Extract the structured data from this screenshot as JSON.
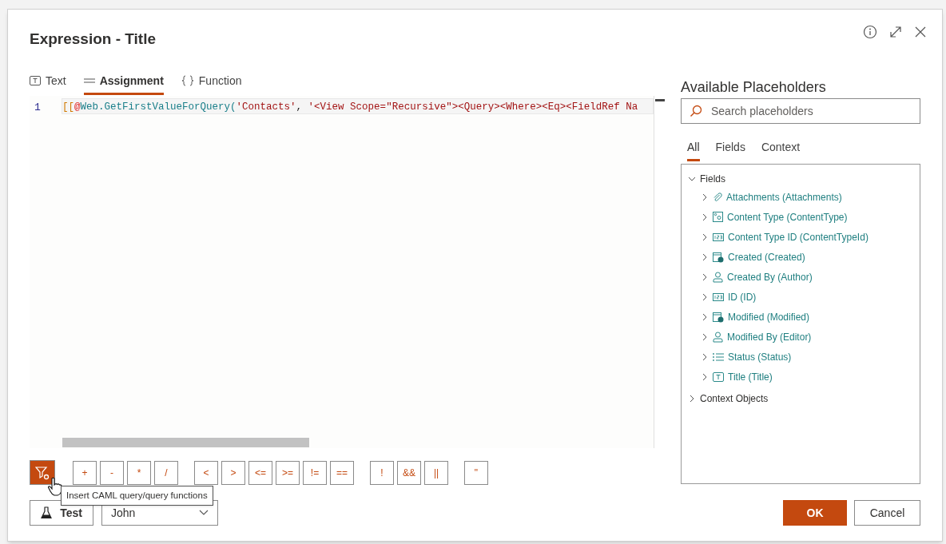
{
  "dialog": {
    "title": "Expression - Title"
  },
  "editor_tabs": [
    {
      "label": "Text",
      "kind": "text",
      "selected": false
    },
    {
      "label": "Assignment",
      "kind": "lines",
      "selected": true
    },
    {
      "label": "Function",
      "kind": "braces",
      "selected": false
    }
  ],
  "editor": {
    "line_number": "1",
    "tokens": [
      {
        "text": "[[",
        "kind": "bracket"
      },
      {
        "text": "@",
        "kind": "at"
      },
      {
        "text": "Web.GetFirstValueForQuery(",
        "kind": "name"
      },
      {
        "text": "'Contacts'",
        "kind": "string"
      },
      {
        "text": ", ",
        "kind": "plain"
      },
      {
        "text": "'<View Scope=\"Recursive\"><Query><Where><Eq><FieldRef Na",
        "kind": "string"
      }
    ]
  },
  "operator_groups": [
    [
      "+",
      "-",
      "*",
      "/"
    ],
    [
      "<",
      ">",
      "<=",
      ">=",
      "!=",
      "=="
    ],
    [
      "!",
      "&&",
      "||"
    ],
    [
      "\""
    ]
  ],
  "tooltip": "Insert CAML query/query functions",
  "test_button": "Test",
  "test_user": "John",
  "placeholders": {
    "title": "Available Placeholders",
    "search_placeholder": "Search placeholders",
    "tabs": [
      {
        "label": "All",
        "selected": true
      },
      {
        "label": "Fields",
        "selected": false
      },
      {
        "label": "Context",
        "selected": false
      }
    ],
    "tree": [
      {
        "label": "Fields",
        "expanded": true,
        "children": [
          {
            "label": "Attachments (Attachments)",
            "kind": "attachment",
            "expanded": false
          },
          {
            "label": "Content Type (ContentType)",
            "kind": "content-type",
            "expanded": false
          },
          {
            "label": "Content Type ID (ContentTypeId)",
            "kind": "number",
            "expanded": false
          },
          {
            "label": "Created (Created)",
            "kind": "date",
            "expanded": false
          },
          {
            "label": "Created By (Author)",
            "kind": "person",
            "expanded": false
          },
          {
            "label": "ID (ID)",
            "kind": "number",
            "expanded": false
          },
          {
            "label": "Modified (Modified)",
            "kind": "date",
            "expanded": false
          },
          {
            "label": "Modified By (Editor)",
            "kind": "person",
            "expanded": false
          },
          {
            "label": "Status (Status)",
            "kind": "list",
            "expanded": false
          },
          {
            "label": "Title (Title)",
            "kind": "text",
            "expanded": false
          }
        ]
      },
      {
        "label": "Context Objects",
        "expanded": false
      }
    ]
  },
  "footer_buttons": [
    {
      "label": "OK",
      "primary": true
    },
    {
      "label": "Cancel",
      "primary": false
    }
  ]
}
